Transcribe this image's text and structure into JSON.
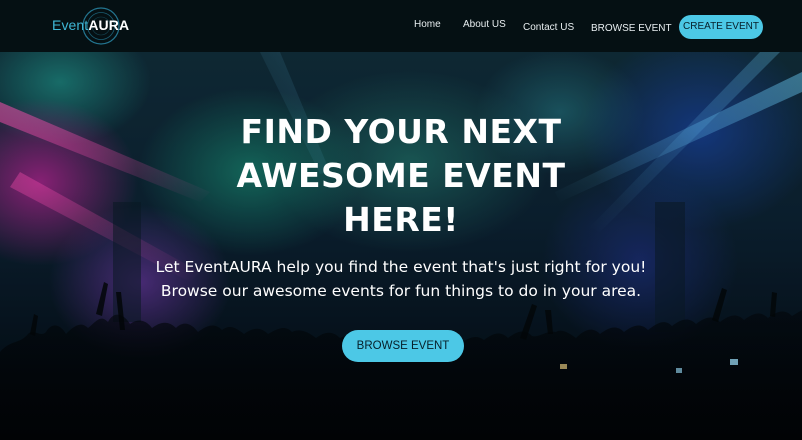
{
  "brand": {
    "name_part1": "Event",
    "name_part2": "AURA",
    "accent_color": "#4cc8e6"
  },
  "nav": {
    "home": "Home",
    "about": "About US",
    "contact": "Contact US",
    "browse": "BROWSE EVENT",
    "create": "CREATE EVENT"
  },
  "hero": {
    "title_line1": "FIND YOUR NEXT",
    "title_line2": "AWESOME EVENT",
    "title_line3": "HERE!",
    "subtitle_line1": "Let EventAURA help you find the event that's just right for you!",
    "subtitle_line2": "Browse our awesome events for fun things to do in your area.",
    "button": "BROWSE EVENT",
    "background_image": "concert-crowd-image"
  }
}
